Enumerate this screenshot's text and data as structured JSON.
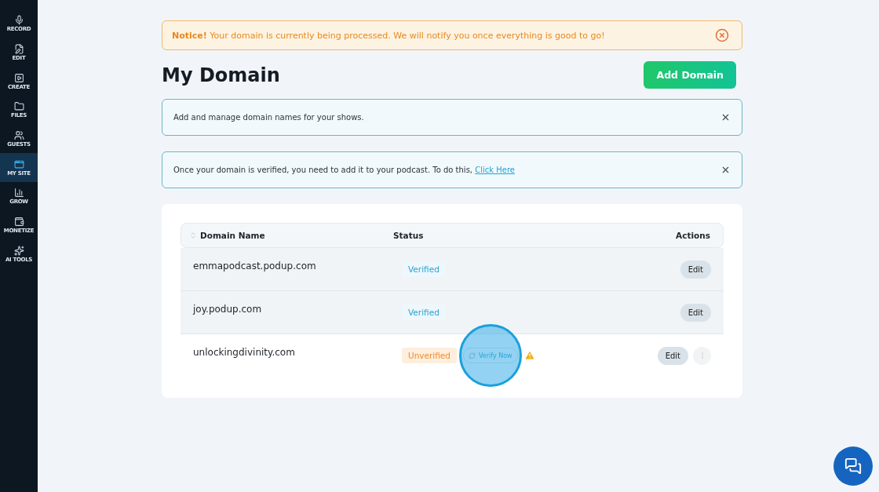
{
  "sidebar": {
    "items": [
      {
        "label": "RECORD",
        "selected": false
      },
      {
        "label": "EDIT",
        "selected": false
      },
      {
        "label": "CREATE",
        "selected": false
      },
      {
        "label": "FILES",
        "selected": false
      },
      {
        "label": "GUESTS",
        "selected": false
      },
      {
        "label": "MY SITE",
        "selected": true
      },
      {
        "label": "GROW",
        "selected": false
      },
      {
        "label": "MONETIZE",
        "selected": false
      },
      {
        "label": "AI TOOLS",
        "selected": false
      }
    ]
  },
  "notice": {
    "text": "**Notice!** Your domain is currently being processed. We will notify you once everything is good to go!"
  },
  "title": "My Domain",
  "add_button": "Add Domain",
  "info_boxes": [
    {
      "text": "Add and manage domain names for your shows."
    },
    {
      "text": "Once your domain is verified, you need to add it to your podcast. To do this,",
      "link": "Click Here"
    }
  ],
  "table": {
    "columns": [
      "Domain Name",
      "Status",
      "Actions"
    ],
    "rows": [
      {
        "domain": "emmapodcast.podup.com",
        "status": "Verified",
        "kind": "verified",
        "shaded": true,
        "action": "Edit"
      },
      {
        "domain": "joy.podup.com",
        "status": "Verified",
        "kind": "verified",
        "shaded": true,
        "action": "Edit"
      },
      {
        "domain": "unlockingdivinity.com",
        "status": "Unverified",
        "kind": "unverified",
        "shaded": false,
        "action": "Edit",
        "verify": "Verify Now"
      }
    ]
  }
}
